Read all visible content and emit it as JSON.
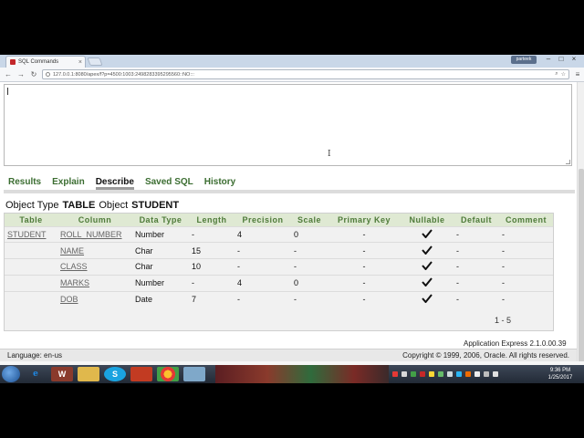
{
  "browser": {
    "tab_title": "SQL Commands",
    "tab_close": "×",
    "user_badge": "parteek",
    "address": "127.0.0.1:8080/apex/f?p=4500:1003:2498283395295560::NO:::"
  },
  "output_tabs": [
    "Results",
    "Explain",
    "Describe",
    "Saved SQL",
    "History"
  ],
  "object_info": {
    "type_label": "Object Type",
    "type_value": "TABLE",
    "object_label": "Object",
    "object_value": "STUDENT"
  },
  "describe_table": {
    "headers": [
      "Table",
      "Column",
      "Data Type",
      "Length",
      "Precision",
      "Scale",
      "Primary Key",
      "Nullable",
      "Default",
      "Comment"
    ],
    "rows": [
      {
        "table": "STUDENT",
        "column": "ROLL_NUMBER",
        "data_type": "Number",
        "length": "-",
        "precision": "4",
        "scale": "0",
        "primary_key": "-",
        "default": "-",
        "comment": "-"
      },
      {
        "table": "",
        "column": "NAME",
        "data_type": "Char",
        "length": "15",
        "precision": "-",
        "scale": "-",
        "primary_key": "-",
        "default": "-",
        "comment": "-"
      },
      {
        "table": "",
        "column": "CLASS",
        "data_type": "Char",
        "length": "10",
        "precision": "-",
        "scale": "-",
        "primary_key": "-",
        "default": "-",
        "comment": "-"
      },
      {
        "table": "",
        "column": "MARKS",
        "data_type": "Number",
        "length": "-",
        "precision": "4",
        "scale": "0",
        "primary_key": "-",
        "default": "-",
        "comment": "-"
      },
      {
        "table": "",
        "column": "DOB",
        "data_type": "Date",
        "length": "7",
        "precision": "-",
        "scale": "-",
        "primary_key": "-",
        "default": "-",
        "comment": "-"
      }
    ],
    "pager": "1 - 5"
  },
  "footer": {
    "version": "Application Express 2.1.0.00.39",
    "language": "Language: en-us",
    "copyright": "Copyright © 1999, 2006, Oracle. All rights reserved."
  },
  "taskbar": {
    "time": "9:36 PM",
    "date": "1/25/2017"
  },
  "colors": {
    "tab_link": "#3b6d31",
    "table_header_bg": "#dfe9d3",
    "table_header_text": "#4f7b3a"
  }
}
